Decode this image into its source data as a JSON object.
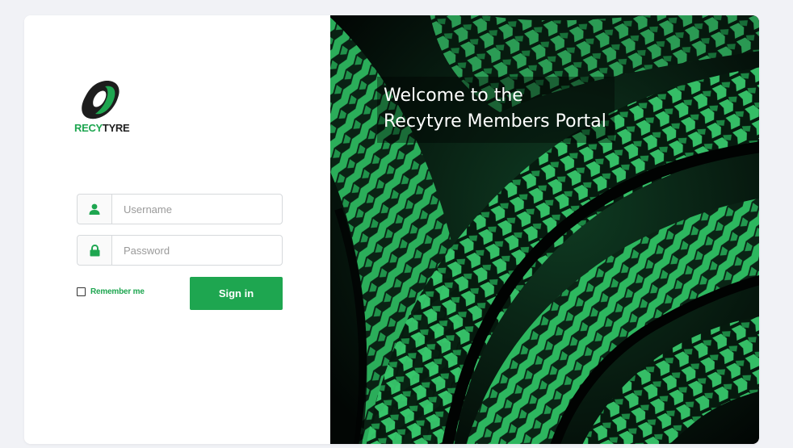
{
  "colors": {
    "brand_green": "#1ea650",
    "hero_dark": "#040a07",
    "hero_green": "#2fbf63"
  },
  "logo": {
    "text_part1": "RECY",
    "text_part2": "TYRE",
    "icon": "tyre-logo-icon"
  },
  "login": {
    "username_placeholder": "Username",
    "username_value": "",
    "username_icon": "user-icon",
    "password_placeholder": "Password",
    "password_value": "",
    "password_icon": "lock-icon",
    "remember_label": "Remember me",
    "signin_label": "Sign in"
  },
  "hero": {
    "title_line1": "Welcome to the",
    "title_line2": "Recytyre Members Portal",
    "image": "green-tyres-photo"
  }
}
